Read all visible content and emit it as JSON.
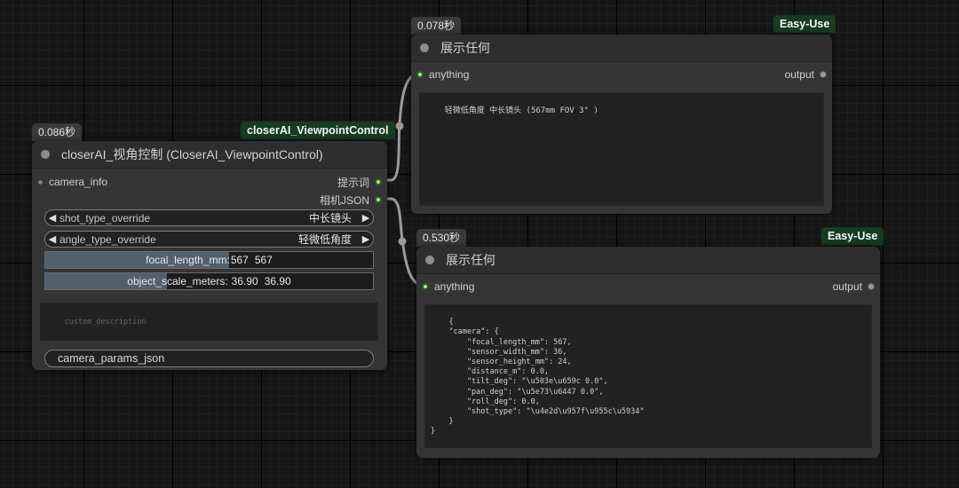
{
  "links_color": "#9a9a9a",
  "node_viewpoint": {
    "exec_time": "0.086秒",
    "tag": "closerAI_ViewpointControl",
    "title": "closerAI_视角控制 (CloserAI_ViewpointControl)",
    "input": "camera_info",
    "outputs": [
      "提示词",
      "相机JSON"
    ],
    "shot_type": {
      "name": "shot_type_override",
      "value": "中长镜头"
    },
    "angle_type": {
      "name": "angle_type_override",
      "value": "轻微低角度"
    },
    "focal_length": {
      "label": "focal_length_mm:",
      "value": "567",
      "value2": "567",
      "fill": 0.56
    },
    "object_scale": {
      "label": "object_scale_meters:",
      "value": "36.90",
      "value2": "36.90",
      "fill": 0.37
    },
    "custom_description_placeholder": "custom_description",
    "button_label": "camera_params_json"
  },
  "node_show_1": {
    "exec_time": "0.078秒",
    "tag": "Easy-Use",
    "title": "展示任何",
    "input": "anything",
    "output": "output",
    "text": "轻微低角度 中长镜头 (567mm FOV 3° )"
  },
  "node_show_2": {
    "exec_time": "0.530秒",
    "tag": "Easy-Use",
    "title": "展示任何",
    "input": "anything",
    "output": "output",
    "text": "{\n    \"camera\": {\n        \"focal_length_mm\": 567,\n        \"sensor_width_mm\": 36,\n        \"sensor_height_mm\": 24,\n        \"distance_m\": 0.0,\n        \"tilt_deg\": \"\\u503e\\u659c 0.0\",\n        \"pan_deg\": \"\\u5e73\\u6447 0.0\",\n        \"roll_deg\": 0.0,\n        \"shot_type\": \"\\u4e2d\\u957f\\u955c\\u5934\"\n    }\n}"
  }
}
